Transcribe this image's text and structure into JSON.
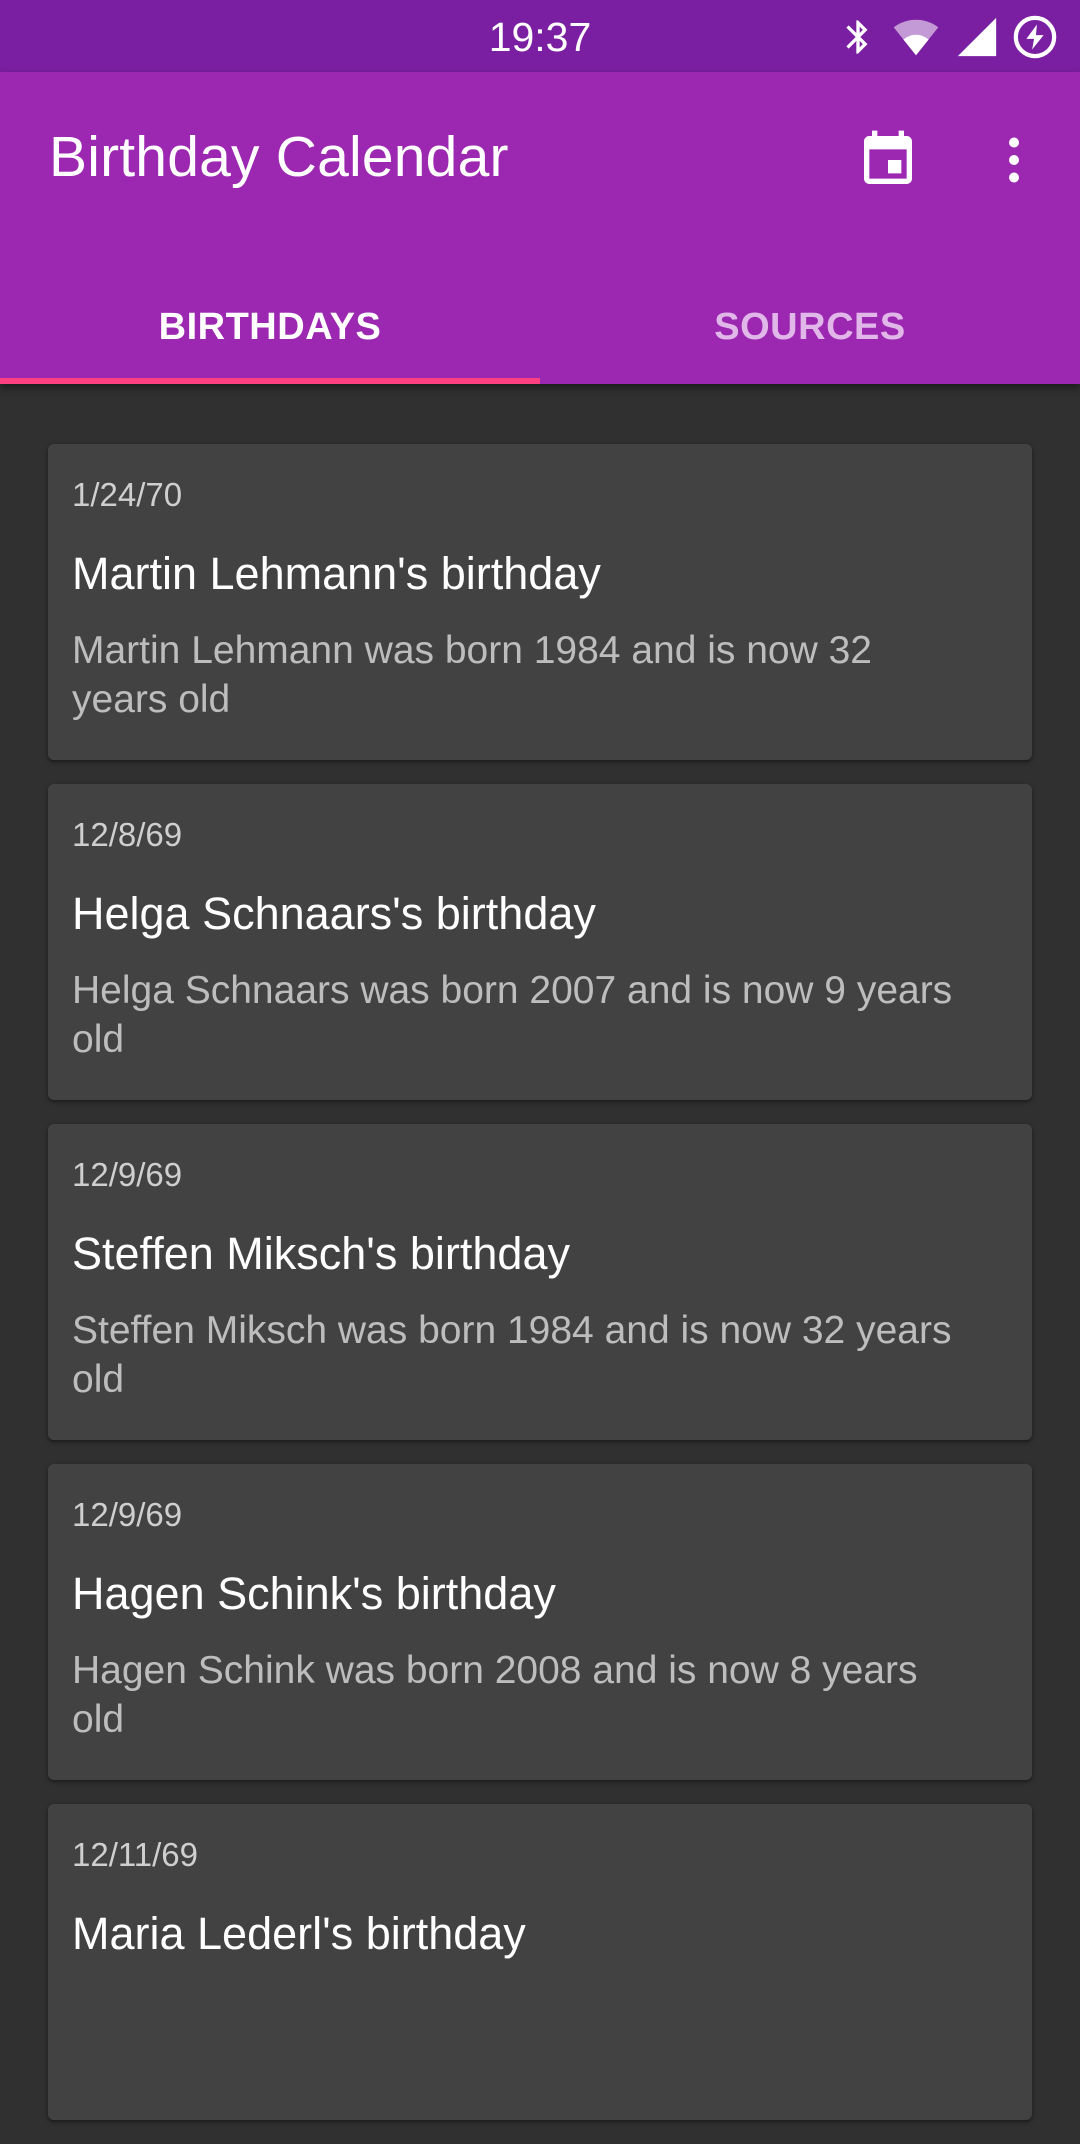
{
  "status_bar": {
    "time": "19:37",
    "icons": [
      "bluetooth-icon",
      "wifi-icon",
      "signal-icon",
      "battery-charging-icon"
    ]
  },
  "app_bar": {
    "title": "Birthday Calendar",
    "actions": [
      "calendar-icon",
      "more-vert-icon"
    ]
  },
  "tabs": [
    {
      "label": "BIRTHDAYS",
      "active": true
    },
    {
      "label": "SOURCES",
      "active": false
    }
  ],
  "birthdays": [
    {
      "date": "1/24/70",
      "title": "Martin Lehmann's birthday",
      "description": "Martin Lehmann was born 1984 and is now 32 years old"
    },
    {
      "date": "12/8/69",
      "title": "Helga Schnaars's birthday",
      "description": "Helga Schnaars was born 2007 and is now 9 years old"
    },
    {
      "date": "12/9/69",
      "title": "Steffen Miksch's birthday",
      "description": "Steffen Miksch was born 1984 and is now 32 years old"
    },
    {
      "date": "12/9/69",
      "title": "Hagen Schink's birthday",
      "description": "Hagen Schink was born 2008 and is now 8 years old"
    },
    {
      "date": "12/11/69",
      "title": "Maria Lederl's birthday",
      "description": ""
    }
  ],
  "colors": {
    "status_bar": "#7b1fa2",
    "primary": "#9c27b0",
    "accent": "#ff4081",
    "background": "#303030",
    "card": "#424242"
  }
}
